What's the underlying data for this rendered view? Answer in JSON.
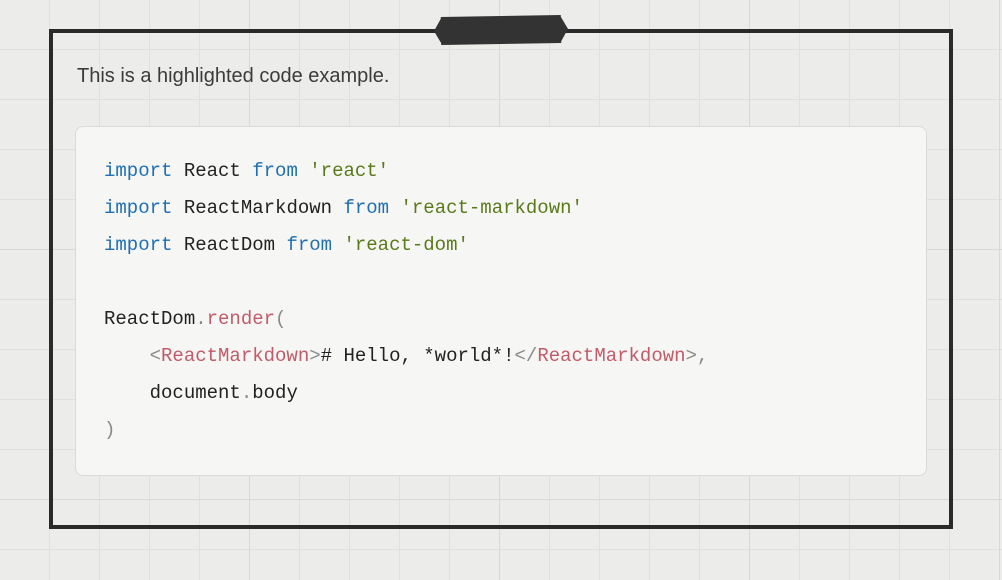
{
  "intro": "This is a highlighted code example.",
  "code": {
    "line1": {
      "kw1": "import",
      "id": "React",
      "kw2": "from",
      "str": "'react'"
    },
    "line2": {
      "kw1": "import",
      "id": "ReactMarkdown",
      "kw2": "from",
      "str": "'react-markdown'"
    },
    "line3": {
      "kw1": "import",
      "id": "ReactDom",
      "kw2": "from",
      "str": "'react-dom'"
    },
    "line5": {
      "obj": "ReactDom",
      "dot": ".",
      "fn": "render",
      "open": "("
    },
    "line6": {
      "indent": "    ",
      "lt1": "<",
      "tag1": "ReactMarkdown",
      "gt1": ">",
      "text": "# Hello, *world*!",
      "lt2": "</",
      "tag2": "ReactMarkdown",
      "gt2": ">",
      "comma": ","
    },
    "line7": {
      "indent": "    ",
      "obj": "document",
      "dot": ".",
      "prop": "body"
    },
    "line8": {
      "close": ")"
    }
  }
}
